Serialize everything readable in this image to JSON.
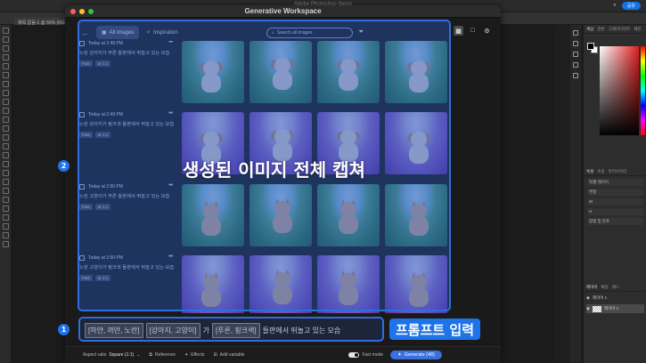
{
  "photoshop": {
    "app_title": "Adobe Photoshop (beta)",
    "doc_tab": "제목 없음-1 @ 50% (RGB/8)",
    "share_label": "공유",
    "color_tabs": [
      "색상",
      "견본",
      "그레이디언트",
      "패턴"
    ],
    "props_tabs": [
      "속성",
      "조정",
      "라이브러리"
    ],
    "props_rows": [
      "픽셀 레이어",
      "변형",
      "W",
      "H",
      "정렬 및 분포"
    ],
    "layers_tabs": [
      "레이어",
      "채널",
      "패스"
    ],
    "layers": [
      {
        "name": "레이어 1",
        "selected": false
      },
      {
        "name": "레이어 1",
        "selected": true
      }
    ]
  },
  "workspace": {
    "title": "Generative Workspace",
    "tabs": {
      "all_images": "All images",
      "inspiration": "Inspiration"
    },
    "search_placeholder": "Search all images",
    "groups": [
      {
        "time": "Today at 2:49 PM",
        "prompt": "노란 강아지가 푸른 들판에서 뛰놀고 있는 모습",
        "tags": [
          "Fast",
          "ar 1:1"
        ],
        "scene": "grass",
        "animal": "dog"
      },
      {
        "time": "Today at 2:49 PM",
        "prompt": "노란 강아지가 핑크색 들판에서 뛰놀고 있는 모습",
        "tags": [
          "Fast",
          "ar 1:1"
        ],
        "scene": "lav",
        "animal": "dog"
      },
      {
        "time": "Today at 2:50 PM",
        "prompt": "노란 고양이가 푸른 들판에서 뛰놀고 있는 모습",
        "tags": [
          "Fast",
          "ar 1:1"
        ],
        "scene": "grass",
        "animal": "cat"
      },
      {
        "time": "Today at 2:50 PM",
        "prompt": "노란 고양이가 핑크색 들판에서 뛰놀고 있는 모습",
        "tags": [
          "Fast",
          "ar 1:1"
        ],
        "scene": "lav",
        "animal": "cat"
      }
    ],
    "prompt_bar": {
      "chip_1": "[하얀, 까만, 노란]",
      "chip_2": "[강아지, 고양이]",
      "connector": "가",
      "chip_3": "[푸른, 핑크색]",
      "tail": "들판에서 뛰놀고 있는 모습"
    },
    "bottom_bar": {
      "aspect_label": "Aspect ratio",
      "aspect_value": "Square (1:1)",
      "reference": "Reference",
      "effects": "Effects",
      "add_variable": "Add variable",
      "fast_mode": "Fast mode",
      "generate": "Generate (48)"
    }
  },
  "annotations": {
    "badge_1": "1",
    "badge_2": "2",
    "gallery_caption": "생성된 이미지 전체 캡쳐",
    "prompt_caption": "프롬프트 입력",
    "highlight_color": "#2f6de0"
  }
}
